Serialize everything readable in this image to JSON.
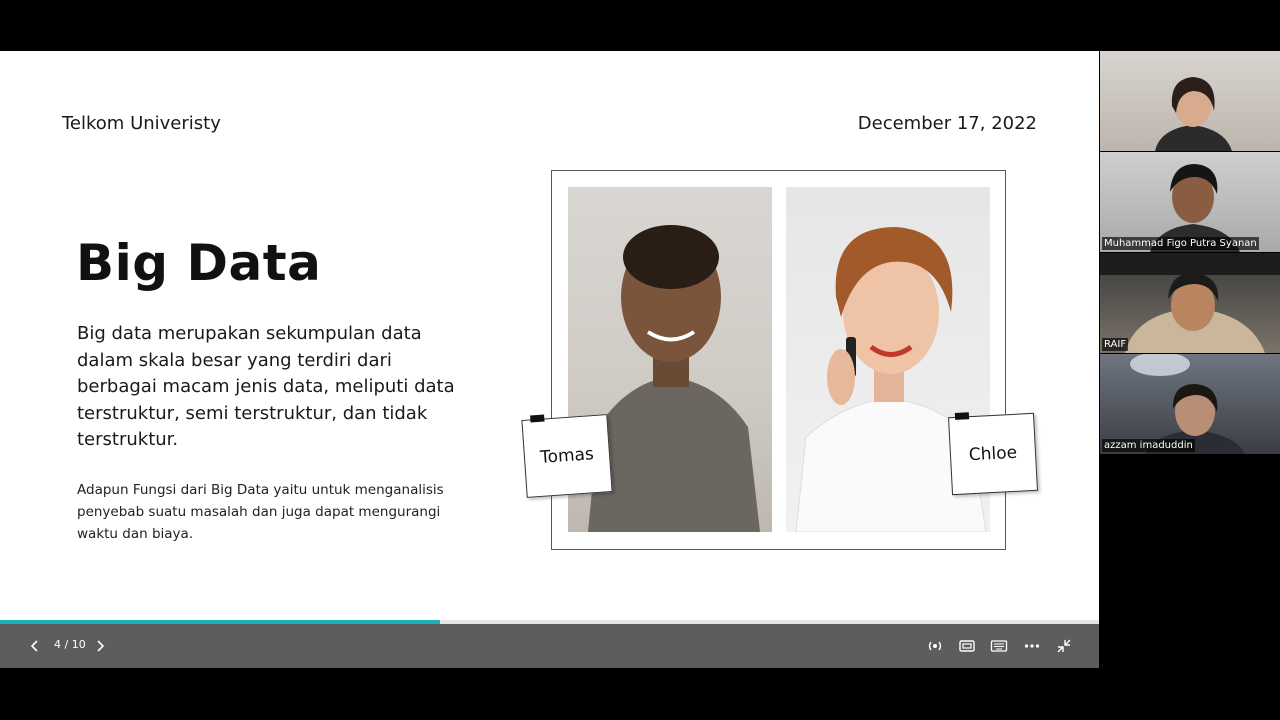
{
  "slide": {
    "org": "Telkom Univeristy",
    "date": "December 17, 2022",
    "title": "Big Data",
    "paragraph": "Big data merupakan sekumpulan data dalam skala besar yang terdiri dari berbagai macam jenis data, meliputi data terstruktur, semi terstruktur, dan tidak terstruktur.",
    "paragraph2": "Adapun Fungsi dari Big Data yaitu untuk menganalisis penyebab suatu masalah dan juga dapat mengurangi waktu dan biaya.",
    "tags": {
      "left": "Tomas",
      "right": "Chloe"
    }
  },
  "presentation": {
    "page_indicator": "4 / 10",
    "progress": 0.4,
    "accent": "#1ab0b8"
  },
  "controls": {
    "prev_icon": "chevron-left-icon",
    "next_icon": "chevron-right-icon",
    "icons": [
      "broadcast-icon",
      "window-icon",
      "keyboard-icon",
      "more-icon",
      "exit-fullscreen-icon"
    ]
  },
  "participants": [
    {
      "name": ""
    },
    {
      "name": "Muhammad Figo Putra Syanan"
    },
    {
      "name": "RAIF"
    },
    {
      "name": "azzam imaduddin"
    }
  ]
}
